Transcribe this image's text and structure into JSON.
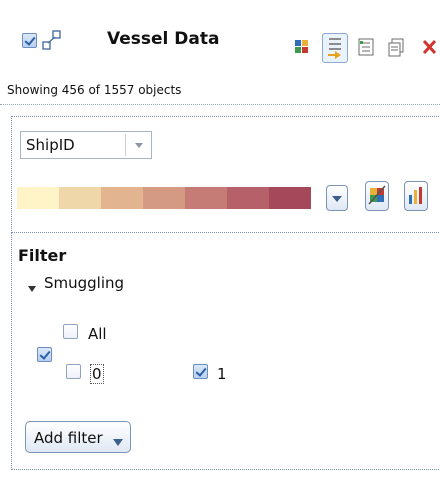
{
  "header": {
    "title": "Vessel Data",
    "status": "Showing 456 of 1557 objects"
  },
  "color_selector": {
    "column": "ShipID",
    "gradient": [
      "#fff4c8",
      "#f0d7aa",
      "#e2b48f",
      "#d59a84",
      "#c67c76",
      "#b6616a",
      "#a4485a",
      "#8e2540"
    ]
  },
  "filter": {
    "heading": "Filter",
    "group_label": "Smuggling",
    "options": [
      {
        "label": "All",
        "checked": false
      },
      {
        "label": "0",
        "checked": false
      },
      {
        "label": "1",
        "checked": true
      }
    ],
    "add_filter_label": "Add filter"
  },
  "colors": {
    "accent_border": "#7a8fb4",
    "delete_red": "#d0342c"
  }
}
